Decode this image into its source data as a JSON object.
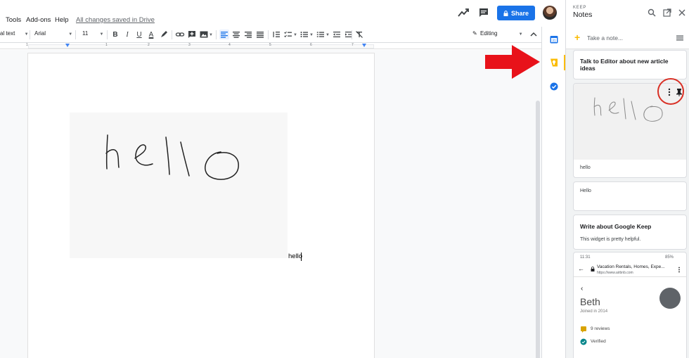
{
  "menu": {
    "items": [
      "Tools",
      "Add-ons",
      "Help"
    ],
    "saved": "All changes saved in Drive"
  },
  "header": {
    "share_label": "Share"
  },
  "toolbar": {
    "style": "al text",
    "font": "Arial",
    "size": "11",
    "mode": "Editing"
  },
  "ruler": {
    "numbers": [
      "1",
      "1",
      "2",
      "3",
      "4",
      "5",
      "6",
      "7"
    ]
  },
  "document": {
    "text": "hello",
    "drawing_text": "hello"
  },
  "keep": {
    "super": "KEEP",
    "title": "Notes",
    "take_note": "Take a note...",
    "notes": [
      {
        "title": "Talk to Editor about new article ideas"
      },
      {
        "drawing_text": "hello",
        "body": "hello"
      },
      {
        "body": "Hello"
      },
      {
        "title": "Write about Google Keep",
        "body": "This widget is pretty helpful."
      }
    ],
    "phone": {
      "time": "11:31",
      "battery": "85%",
      "page_title": "Vacation Rentals, Homes, Expe...",
      "url": "https://www.airbnb.com",
      "name": "Beth",
      "joined": "Joined in 2014",
      "reviews": "9 reviews",
      "verified": "Verified"
    }
  },
  "colors": {
    "accent": "#1a73e8",
    "keep_yellow": "#fbbc04",
    "annotation_red": "#e8121a"
  }
}
